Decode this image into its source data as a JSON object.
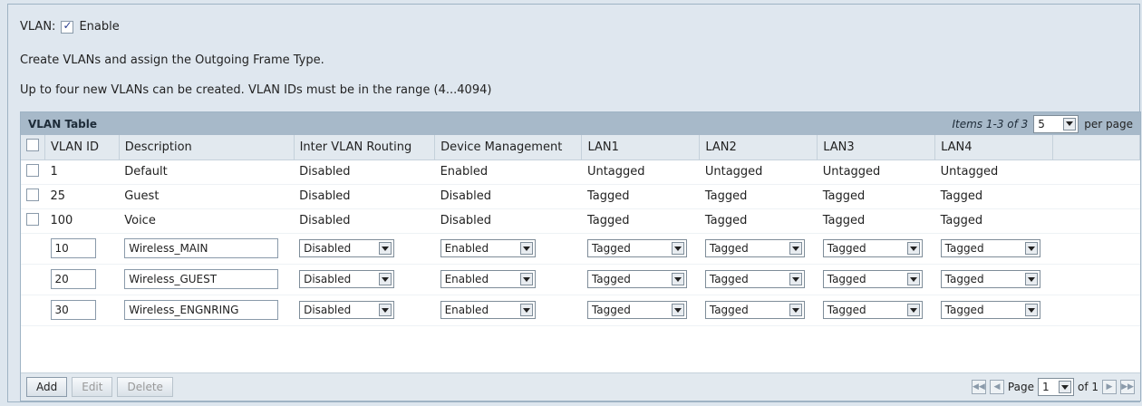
{
  "vlan": {
    "label": "VLAN:",
    "enable_label": "Enable",
    "enabled": true
  },
  "intro": {
    "line1": "Create VLANs and assign the Outgoing Frame Type.",
    "line2": "Up to four new VLANs can be created. VLAN IDs must be in the range (4...4094)"
  },
  "table": {
    "title": "VLAN Table",
    "items_text": "Items 1-3 of 3",
    "per_page_value": "5",
    "per_page_label": "per page",
    "columns": [
      "",
      "VLAN ID",
      "Description",
      "Inter VLAN Routing",
      "Device Management",
      "LAN1",
      "LAN2",
      "LAN3",
      "LAN4",
      ""
    ],
    "rows": [
      {
        "id": "1",
        "description": "Default",
        "routing": "Disabled",
        "device_mgmt": "Enabled",
        "lan1": "Untagged",
        "lan2": "Untagged",
        "lan3": "Untagged",
        "lan4": "Untagged"
      },
      {
        "id": "25",
        "description": "Guest",
        "routing": "Disabled",
        "device_mgmt": "Disabled",
        "lan1": "Tagged",
        "lan2": "Tagged",
        "lan3": "Tagged",
        "lan4": "Tagged"
      },
      {
        "id": "100",
        "description": "Voice",
        "routing": "Disabled",
        "device_mgmt": "Disabled",
        "lan1": "Tagged",
        "lan2": "Tagged",
        "lan3": "Tagged",
        "lan4": "Tagged"
      }
    ],
    "edit_rows": [
      {
        "id": "10",
        "description": "Wireless_MAIN",
        "routing": "Disabled",
        "device_mgmt": "Enabled",
        "lan1": "Tagged",
        "lan2": "Tagged",
        "lan3": "Tagged",
        "lan4": "Tagged"
      },
      {
        "id": "20",
        "description": "Wireless_GUEST",
        "routing": "Disabled",
        "device_mgmt": "Enabled",
        "lan1": "Tagged",
        "lan2": "Tagged",
        "lan3": "Tagged",
        "lan4": "Tagged"
      },
      {
        "id": "30",
        "description": "Wireless_ENGNRING",
        "routing": "Disabled",
        "device_mgmt": "Enabled",
        "lan1": "Tagged",
        "lan2": "Tagged",
        "lan3": "Tagged",
        "lan4": "Tagged"
      }
    ]
  },
  "footer": {
    "add_label": "Add",
    "edit_label": "Edit",
    "delete_label": "Delete",
    "page_label": "Page",
    "page_value": "1",
    "of_label": "of 1"
  }
}
